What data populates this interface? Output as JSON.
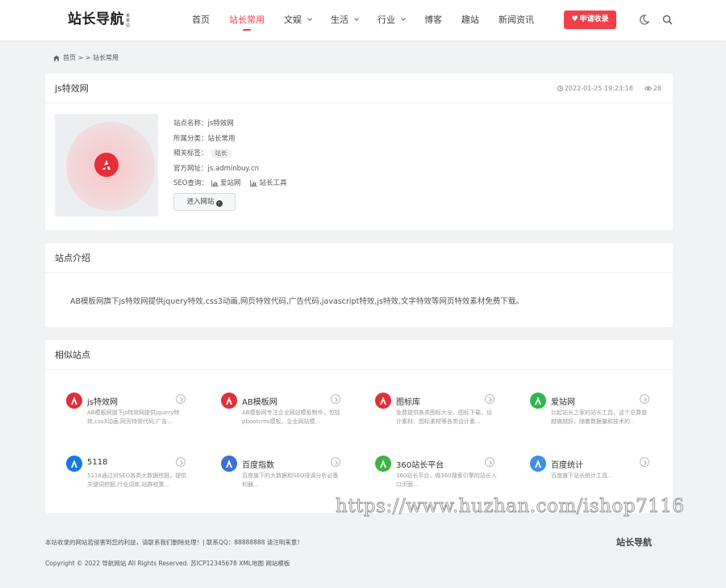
{
  "header": {
    "logo": {
      "text": "站长导航",
      "badge": "某某站"
    },
    "nav": [
      {
        "label": "首页",
        "dropdown": false
      },
      {
        "label": "站长常用",
        "dropdown": false,
        "active": true
      },
      {
        "label": "文娱",
        "dropdown": true
      },
      {
        "label": "生活",
        "dropdown": true
      },
      {
        "label": "行业",
        "dropdown": true
      },
      {
        "label": "博客",
        "dropdown": false
      },
      {
        "label": "趣站",
        "dropdown": false
      },
      {
        "label": "新闻资讯",
        "dropdown": false
      }
    ],
    "apply_button": "申请收录",
    "icons": [
      "heart-icon",
      "moon-icon",
      "search-icon"
    ]
  },
  "breadcrumb": "首页 > > 站长常用",
  "site": {
    "title": "js特效网",
    "datetime": "2022-01-25 19:23:18",
    "views": "28",
    "rows": {
      "name_label": "站点名称：",
      "name_value": "js特效网",
      "category_label": "所属分类：",
      "category_value": "站长常用",
      "tags_label": "相关标签：",
      "tag": "站长",
      "url_label": "官方网址：",
      "url_value": "js.adminbuy.cn",
      "seo_label": "SEO查询：",
      "seo_links": [
        "爱站网",
        "站长工具"
      ]
    },
    "visit_button": "进入网站"
  },
  "intro": {
    "heading": "站点介绍",
    "text": "AB模板网旗下js特效网提供jquery特效,css3动画,网页特效代码,广告代码,javascript特效,js特效,文字特效等网页特效素材免费下载。"
  },
  "related": {
    "heading": "相似站点",
    "items": [
      {
        "name": "js特效网",
        "desc": "AB模板网旗下js特效网提供jquery特效,css3动画,网页特效代码,广告...",
        "icon": "red-a-logo-icon",
        "color": "#e52e3a"
      },
      {
        "name": "AB模板网",
        "desc": "AB模板网专注企业网站模板制作，包括pbootcms模板，企业网站模...",
        "icon": "red-a-logo-icon",
        "color": "#e52e3a"
      },
      {
        "name": "图标库",
        "desc": "免费提供各类图标大全、图标下载、设计素材、图标素材等各类设计素...",
        "icon": "red-a-logo-icon",
        "color": "#e52e3a"
      },
      {
        "name": "爱站网",
        "desc": "比起站长之家的站长工具，这个总算是越做越好、随着数据量和技术的...",
        "icon": "aizhan-logo-icon",
        "color": "#2db84d"
      },
      {
        "name": "5118",
        "desc": "5118通过对SEO各类大数据挖掘，提供关键词挖掘,行业词库,站群权重...",
        "icon": "5118-logo-icon",
        "color": "#1677e5"
      },
      {
        "name": "百度指数",
        "desc": "百度旗下的大数据和SEO排调分析必备利器...",
        "icon": "baidu-paw-icon",
        "color": "#3a6fd8"
      },
      {
        "name": "360站长平台",
        "desc": "360站长平台，做360搜索引擎的站长入口页面...",
        "icon": "360-logo-icon",
        "color": "#3fb33f"
      },
      {
        "name": "百度统计",
        "desc": "百度旗下站长统计工具...",
        "icon": "baidu-tongji-icon",
        "color": "#3d8ee8"
      }
    ]
  },
  "footer": {
    "notice": "本站收录的网站若侵害到您的利益，请联系我们删除处理！| 联系QQ：88888888 请注明来意！",
    "copyright": "Copyright © 2022 导航网站 All Rights Reserved. 苏ICP12345678 XML地图 网站模板",
    "logo": "站长导航"
  },
  "watermark": "https://www.huzhan.com/ishop7116"
}
